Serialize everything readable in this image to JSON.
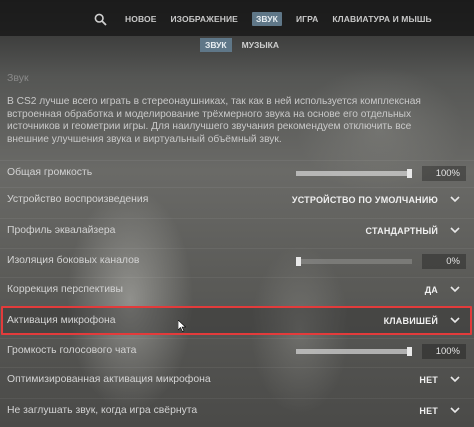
{
  "topnav": {
    "search_icon": "search-icon",
    "items": [
      "НОВОЕ",
      "ИЗОБРАЖЕНИЕ",
      "ЗВУК",
      "ИГРА",
      "КЛАВИАТУРА И МЫШЬ"
    ],
    "active": "ЗВУК"
  },
  "subnav": {
    "items": [
      "ЗВУК",
      "МУЗЫКА"
    ],
    "active": "ЗВУК"
  },
  "section": {
    "title": "Звук",
    "description": "В CS2 лучше всего играть в стереонаушниках, так как в ней используется комплексная встроенная обработка и моделирование трёхмерного звука на основе его отдельных источников и геометрии игры. Для наилучшего звучания рекомендуем отключить все внешние улучшения звука и виртуальный объёмный звук."
  },
  "settings": [
    {
      "label": "Общая громкость",
      "type": "slider",
      "value_text": "100%",
      "level": 1.0
    },
    {
      "label": "Устройство воспроизведения",
      "type": "dropdown",
      "value": "УСТРОЙСТВО ПО УМОЛЧАНИЮ"
    },
    {
      "label": "Профиль эквалайзера",
      "type": "dropdown",
      "value": "СТАНДАРТНЫЙ"
    },
    {
      "label": "Изоляция боковых каналов",
      "type": "slider",
      "value_text": "0%",
      "level": 0.0
    },
    {
      "label": "Коррекция перспективы",
      "type": "dropdown",
      "value": "ДА"
    },
    {
      "label": "Активация микрофона",
      "type": "dropdown",
      "value": "КЛАВИШЕЙ",
      "highlighted": true
    },
    {
      "label": "Громкость голосового чата",
      "type": "slider",
      "value_text": "100%",
      "level": 1.0
    },
    {
      "label": "Оптимизированная активация микрофона",
      "type": "dropdown",
      "value": "НЕТ"
    },
    {
      "label": "Не заглушать звук, когда игра свёрнута",
      "type": "dropdown",
      "value": "НЕТ"
    }
  ],
  "colors": {
    "active_tab": "#5f7788",
    "highlight_border": "#e33b3b"
  }
}
